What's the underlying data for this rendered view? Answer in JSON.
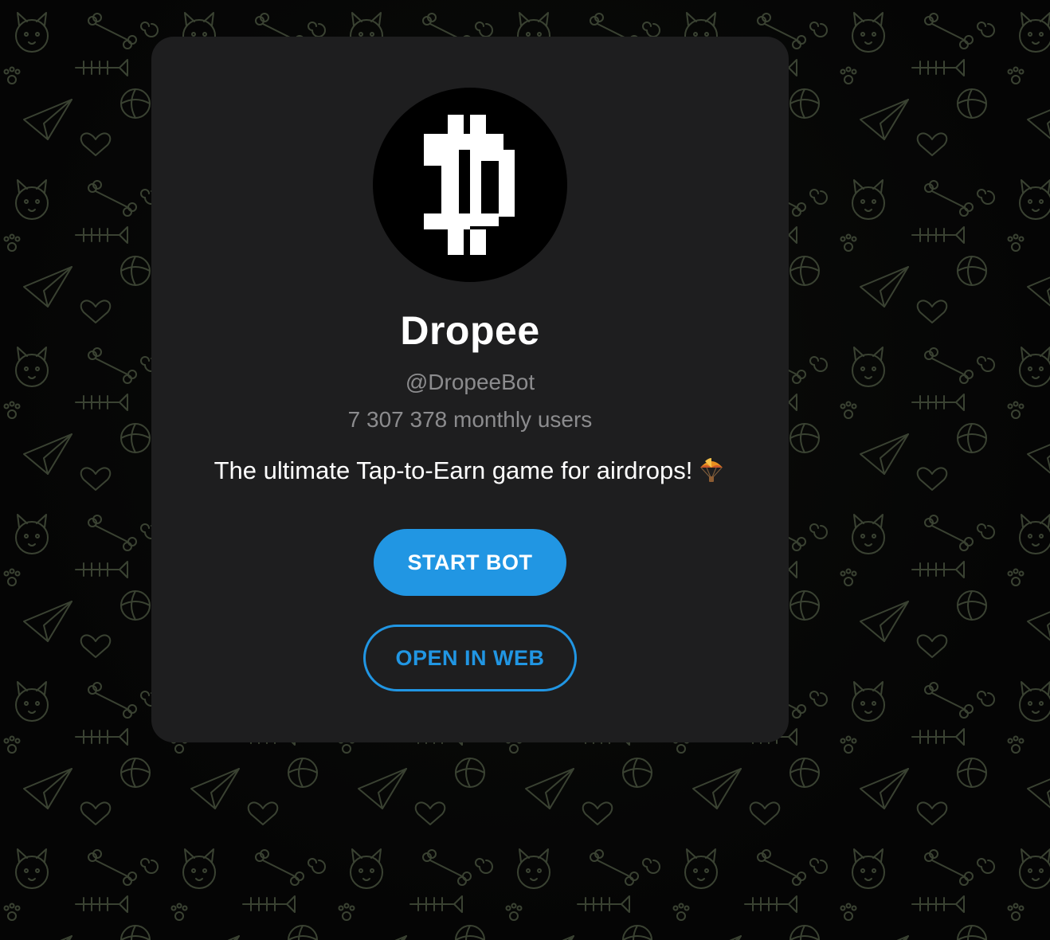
{
  "bot": {
    "name": "Dropee",
    "handle": "@DropeeBot",
    "monthly_users": "7 307 378 monthly users",
    "description": "The ultimate Tap-to-Earn game for airdrops!",
    "description_icon": "parachute-icon",
    "avatar_icon": "dropee-logo-icon"
  },
  "actions": {
    "start_label": "START BOT",
    "open_web_label": "OPEN IN WEB"
  },
  "colors": {
    "accent": "#2196e3",
    "card_bg": "#1e1e1f",
    "page_bg": "#050505",
    "muted_text": "#8c8c8e",
    "doodle_stroke": "#3a4232"
  },
  "background": {
    "pattern_icon": "doodle-pattern"
  }
}
